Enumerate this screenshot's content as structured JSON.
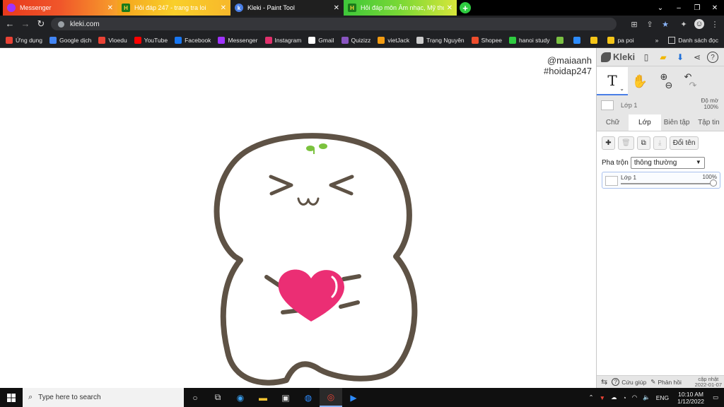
{
  "browser": {
    "tabs": [
      {
        "title": "Messenger",
        "icon": "messenger-icon"
      },
      {
        "title": "Hỏi đáp 247 - trang tra loi",
        "icon": "hoidap-icon"
      },
      {
        "title": "Kleki - Paint Tool",
        "icon": "kleki-icon",
        "active": true
      },
      {
        "title": "Hỏi đáp môn Âm nhạc, Mỹ thuật -",
        "icon": "hoidap-icon"
      }
    ],
    "url": "kleki.com",
    "bookmarks": [
      {
        "label": "Ứng dụng",
        "color": "#e94235"
      },
      {
        "label": "Google dịch",
        "color": "#4285f4"
      },
      {
        "label": "Vioedu",
        "color": "#e94235"
      },
      {
        "label": "YouTube",
        "color": "#ff0000"
      },
      {
        "label": "Facebook",
        "color": "#1877f2"
      },
      {
        "label": "Messenger",
        "color": "#a033ff"
      },
      {
        "label": "Instagram",
        "color": "#e1306c"
      },
      {
        "label": "Gmail",
        "color": "#ffffff"
      },
      {
        "label": "Quizizz",
        "color": "#8854c0"
      },
      {
        "label": "vietJack",
        "color": "#f39c12"
      },
      {
        "label": "Trạng Nguyên",
        "color": "#cccccc"
      },
      {
        "label": "Shopee",
        "color": "#ee4d2d"
      },
      {
        "label": "hanoi study",
        "color": "#2ecc40"
      },
      {
        "label": "",
        "color": "#7ac142"
      },
      {
        "label": "",
        "color": "#2d8cff"
      },
      {
        "label": "",
        "color": "#f5c518"
      },
      {
        "label": "pa poi",
        "color": "#f5c518"
      }
    ],
    "bookmarks_more": "»",
    "reading_list": "Danh sách đọc"
  },
  "canvas": {
    "watermark_line1": "@maiaanh",
    "watermark_line2": "#hoidap247",
    "colors": {
      "outline": "#5e5245",
      "heart": "#eb2e74",
      "sprout": "#7bc23e"
    }
  },
  "kleki": {
    "logo": "Kleki",
    "text_tool": "T",
    "layer_name": "Lớp 1",
    "opacity_label": "Độ mờ",
    "opacity_value": "100%",
    "tabs": [
      "Chữ",
      "Lớp",
      "Biên tập",
      "Tập tin"
    ],
    "active_tab": "Lớp",
    "rename_button": "Đổi tên",
    "blend_label": "Pha trộn",
    "blend_value": "thông thường",
    "layer_card_name": "Lớp 1",
    "layer_card_opacity": "100%",
    "footer": {
      "help": "Cứu giúp",
      "feedback": "Phản hồi",
      "update_line1": "cập nhật",
      "update_line2": "2022-01-07"
    }
  },
  "taskbar": {
    "search_placeholder": "Type here to search",
    "language": "ENG",
    "time": "10:10 AM",
    "date": "1/12/2022"
  }
}
